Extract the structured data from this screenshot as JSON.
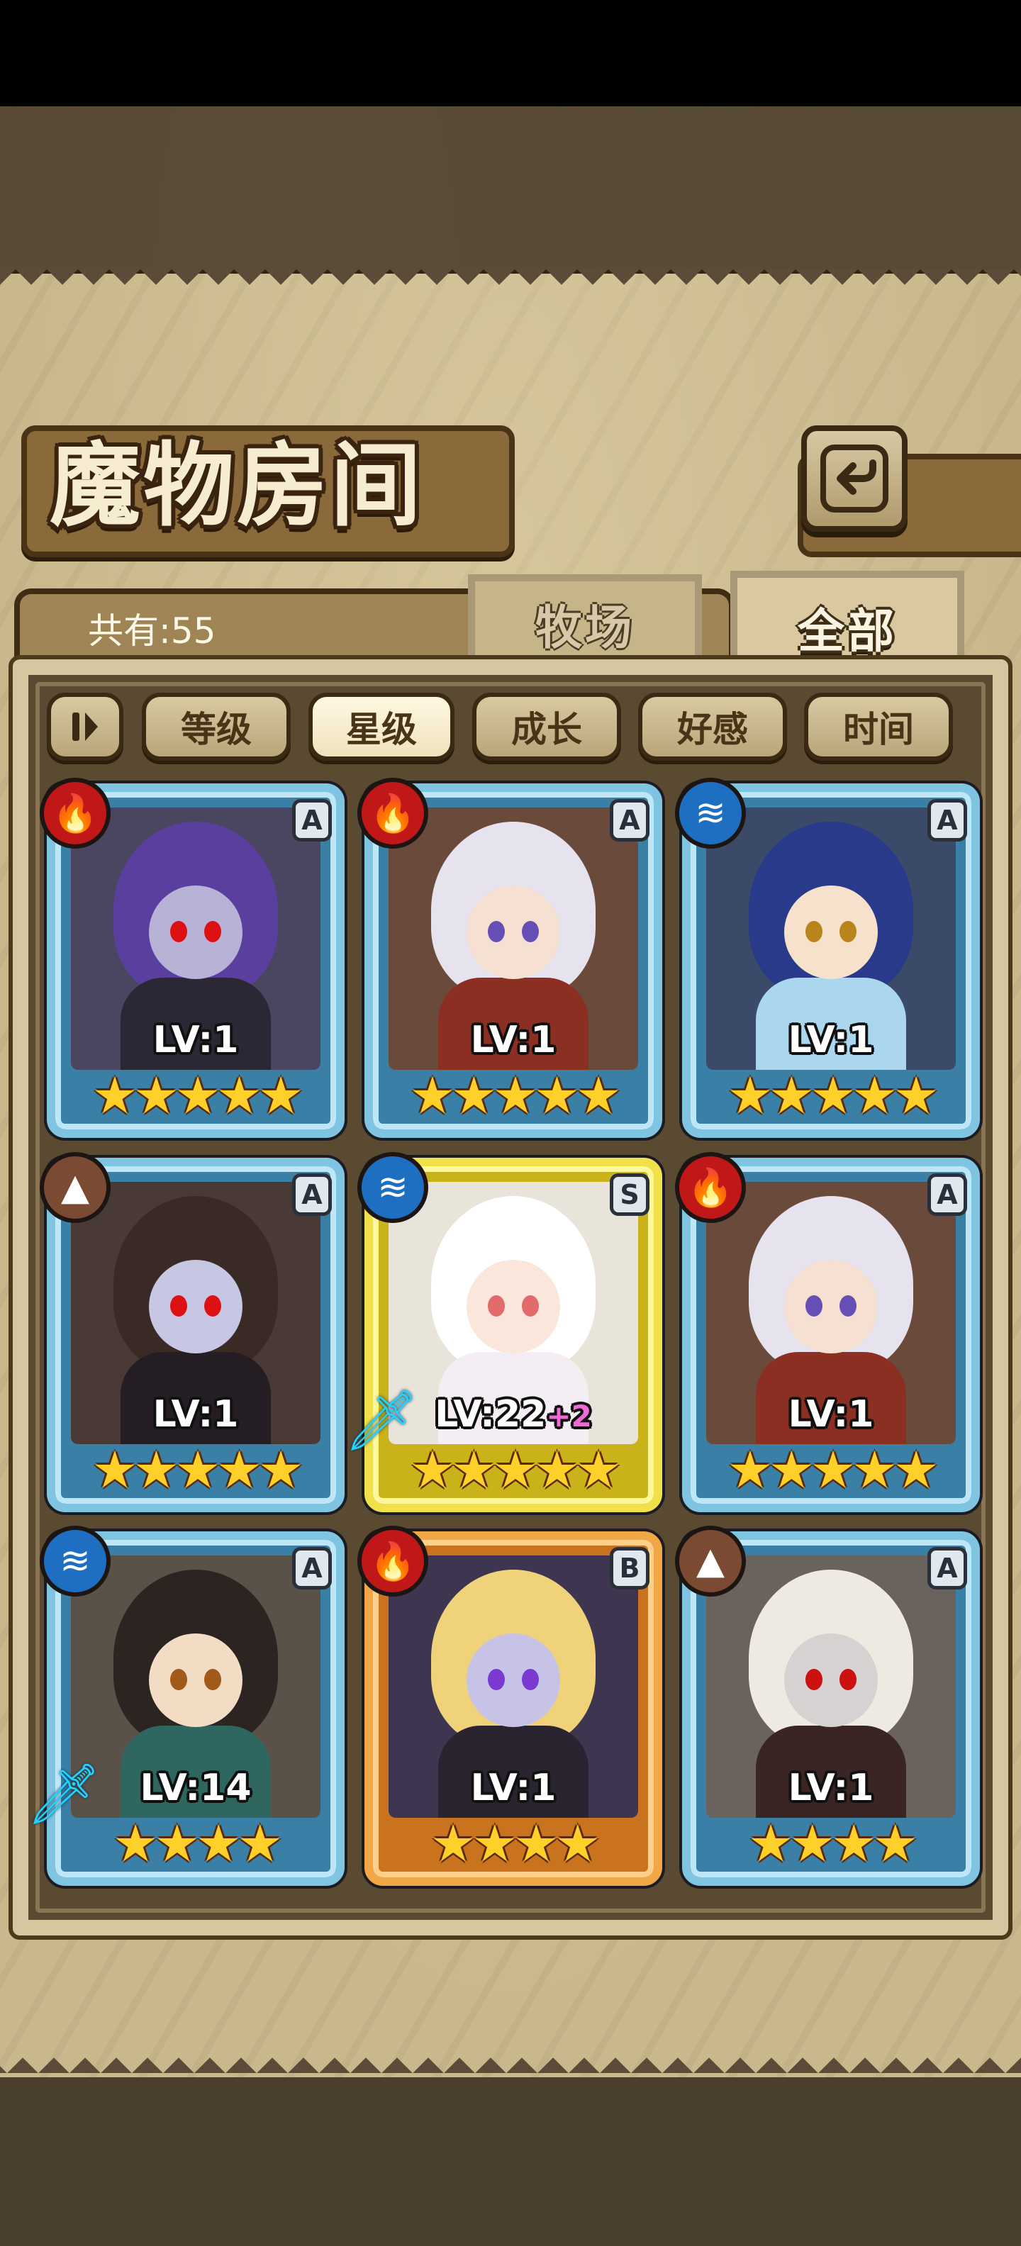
{
  "page": {
    "title": "魔物房间",
    "count_label": "共有:55"
  },
  "tabs": [
    {
      "label": "牧场",
      "active": false
    },
    {
      "label": "全部",
      "active": true
    }
  ],
  "sort_buttons": [
    {
      "label": "等级",
      "active": false
    },
    {
      "label": "星级",
      "active": true
    },
    {
      "label": "成长",
      "active": false
    },
    {
      "label": "好感",
      "active": false
    },
    {
      "label": "时间",
      "active": false
    }
  ],
  "icons": {
    "back": "back-arrow-icon",
    "sort_toggle": "sort-order-icon",
    "fire": "fire-element-icon",
    "water": "water-element-icon",
    "earth": "earth-element-icon",
    "weapon": "sword-icon"
  },
  "colors": {
    "fire": "#c01818",
    "water": "#1e6fc2",
    "earth": "#7a4a32",
    "frame_blue": "#7fc4e0",
    "frame_gold": "#f0e04a",
    "frame_orange": "#f2a746",
    "star": "#ffcf2a"
  },
  "monsters": [
    {
      "element": "fire",
      "rank": "A",
      "level": "LV:1",
      "plus": "",
      "stars": "★★★★★",
      "weapon": false,
      "tone": "blue"
    },
    {
      "element": "fire",
      "rank": "A",
      "level": "LV:1",
      "plus": "",
      "stars": "★★★★★",
      "weapon": false,
      "tone": "blue"
    },
    {
      "element": "water",
      "rank": "A",
      "level": "LV:1",
      "plus": "",
      "stars": "★★★★★",
      "weapon": false,
      "tone": "blue"
    },
    {
      "element": "earth",
      "rank": "A",
      "level": "LV:1",
      "plus": "",
      "stars": "★★★★★",
      "weapon": false,
      "tone": "blue"
    },
    {
      "element": "water",
      "rank": "S",
      "level": "LV:22",
      "plus": "+2",
      "stars": "★★★★★",
      "weapon": true,
      "tone": "gold"
    },
    {
      "element": "fire",
      "rank": "A",
      "level": "LV:1",
      "plus": "",
      "stars": "★★★★★",
      "weapon": false,
      "tone": "blue"
    },
    {
      "element": "water",
      "rank": "A",
      "level": "LV:14",
      "plus": "",
      "stars": "★★★★",
      "weapon": true,
      "tone": "blue"
    },
    {
      "element": "fire",
      "rank": "B",
      "level": "LV:1",
      "plus": "",
      "stars": "★★★★",
      "weapon": false,
      "tone": "orange"
    },
    {
      "element": "earth",
      "rank": "A",
      "level": "LV:1",
      "plus": "",
      "stars": "★★★★",
      "weapon": false,
      "tone": "blue"
    }
  ]
}
